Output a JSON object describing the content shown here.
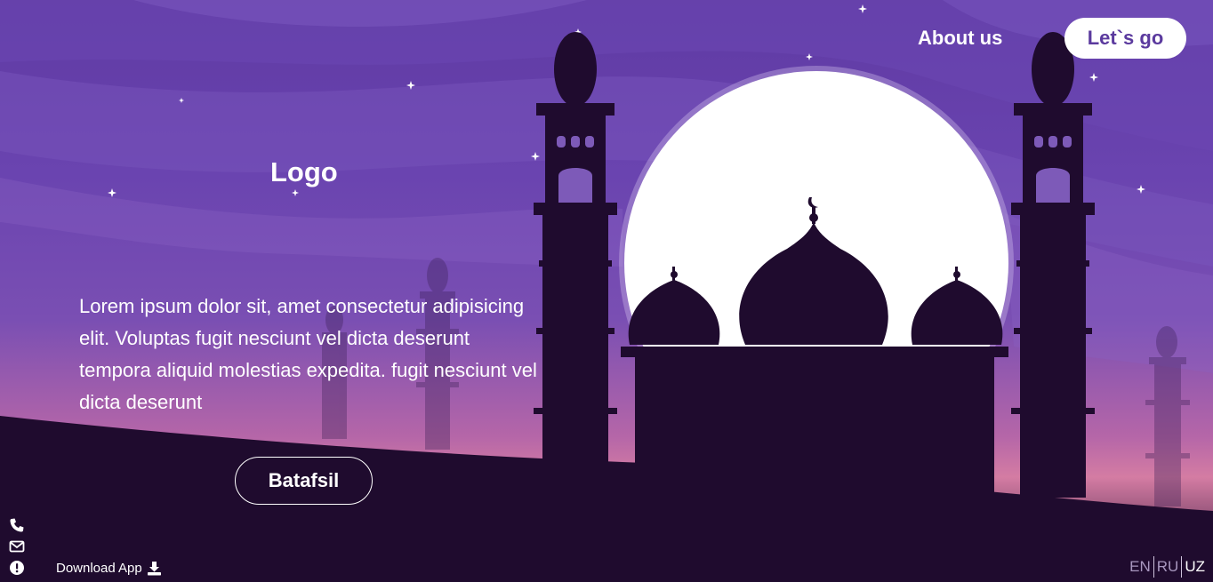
{
  "nav": {
    "about_label": "About us",
    "cta_label": "Let`s go"
  },
  "logo": {
    "text": "Logo"
  },
  "hero": {
    "description": "Lorem ipsum dolor sit, amet consectetur adipisicing elit. Voluptas fugit nesciunt vel dicta deserunt tempora aliquid molestias expedita. fugit nesciunt vel dicta deserunt",
    "button_label": "Batafsil"
  },
  "footer": {
    "download_label": "Download App",
    "icons": [
      "phone-icon",
      "envelope-icon",
      "alert-icon",
      "download-icon"
    ],
    "languages": [
      {
        "code": "EN",
        "active": false
      },
      {
        "code": "RU",
        "active": false
      },
      {
        "code": "UZ",
        "active": true
      }
    ]
  },
  "colors": {
    "sky_top": "#5f3aa3",
    "sky_mid": "#7a4fb3",
    "horizon": "#d47ca3",
    "silhouette": "#1f0b2e",
    "moon": "#ffffff",
    "cta_text": "#5b3a9e"
  }
}
